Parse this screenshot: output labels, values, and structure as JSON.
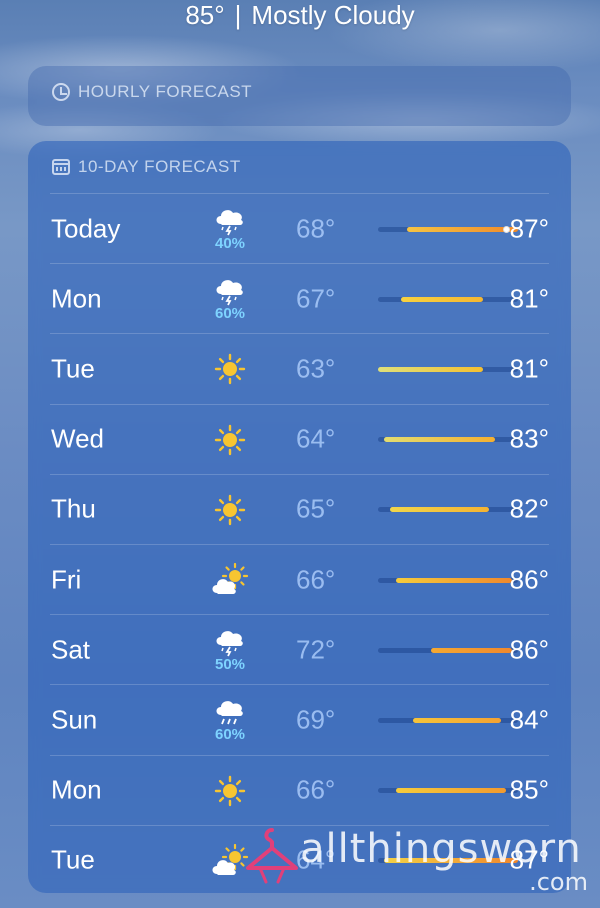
{
  "header": {
    "temp": "85°",
    "separator": "|",
    "condition": "Mostly Cloudy"
  },
  "hourly": {
    "label": "HOURLY FORECAST",
    "icon": "clock-icon"
  },
  "ten_day": {
    "label": "10-DAY FORECAST",
    "icon": "calendar-icon",
    "range_min": 63,
    "range_max": 87,
    "days": [
      {
        "day": "Today",
        "icon": "thunderstorm-icon",
        "pop": "40%",
        "lo": "68°",
        "hi": "87°",
        "low_val": 68,
        "high_val": 87,
        "current": 85,
        "color_start": "#f6c443",
        "color_end": "#f08a2a"
      },
      {
        "day": "Mon",
        "icon": "thunderstorm-icon",
        "pop": "60%",
        "lo": "67°",
        "hi": "81°",
        "low_val": 67,
        "high_val": 81,
        "color_start": "#f8d23f",
        "color_end": "#f5b731"
      },
      {
        "day": "Tue",
        "icon": "sun-icon",
        "pop": "",
        "lo": "63°",
        "hi": "81°",
        "low_val": 63,
        "high_val": 81,
        "color_start": "#dfe07a",
        "color_end": "#f5c030"
      },
      {
        "day": "Wed",
        "icon": "sun-icon",
        "pop": "",
        "lo": "64°",
        "hi": "83°",
        "low_val": 64,
        "high_val": 83,
        "color_start": "#e3dd70",
        "color_end": "#f5b030"
      },
      {
        "day": "Thu",
        "icon": "sun-icon",
        "pop": "",
        "lo": "65°",
        "hi": "82°",
        "low_val": 65,
        "high_val": 82,
        "color_start": "#f2d64a",
        "color_end": "#f5b332"
      },
      {
        "day": "Fri",
        "icon": "partly-cloudy-icon",
        "pop": "",
        "lo": "66°",
        "hi": "86°",
        "low_val": 66,
        "high_val": 86,
        "color_start": "#f6cc3c",
        "color_end": "#f0882c"
      },
      {
        "day": "Sat",
        "icon": "thunderstorm-icon",
        "pop": "50%",
        "lo": "72°",
        "hi": "86°",
        "low_val": 72,
        "high_val": 86,
        "color_start": "#f5a932",
        "color_end": "#f0882c"
      },
      {
        "day": "Sun",
        "icon": "rain-icon",
        "pop": "60%",
        "lo": "69°",
        "hi": "84°",
        "low_val": 69,
        "high_val": 84,
        "color_start": "#f6c43a",
        "color_end": "#f4a232"
      },
      {
        "day": "Mon",
        "icon": "sun-icon",
        "pop": "",
        "lo": "66°",
        "hi": "85°",
        "low_val": 66,
        "high_val": 85,
        "color_start": "#f6cc3c",
        "color_end": "#f29a2f"
      },
      {
        "day": "Tue",
        "icon": "partly-cloudy-icon",
        "pop": "",
        "lo": "64°",
        "hi": "87°",
        "low_val": 64,
        "high_val": 87,
        "color_start": "#f3d246",
        "color_end": "#f0862c"
      }
    ]
  },
  "watermark": {
    "text": "allthingsworn",
    "suffix": ".com",
    "icon": "hanger-icon",
    "color": "#e0407a"
  }
}
